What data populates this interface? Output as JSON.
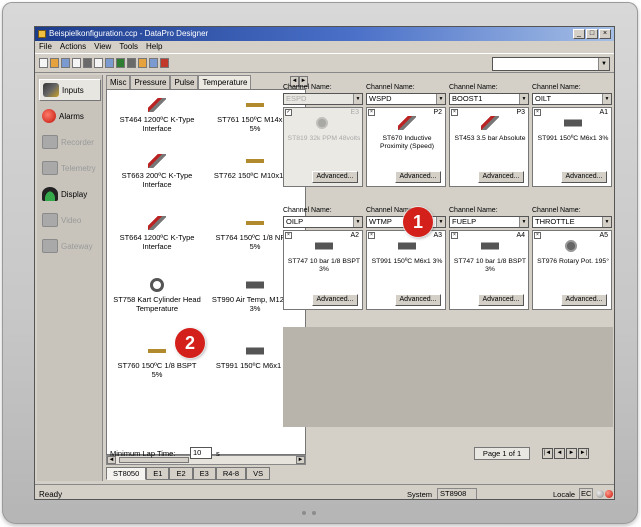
{
  "window": {
    "title": "Beispielkonfiguration.ccp - DataPro Designer",
    "controls": [
      "_",
      "□",
      "×"
    ]
  },
  "menu": [
    "File",
    "Actions",
    "View",
    "Tools",
    "Help"
  ],
  "toolbar_icons": [
    "new-icon",
    "open-icon",
    "save-icon",
    "copy-icon",
    "paste-icon",
    "print-icon",
    "send-icon",
    "receive-icon",
    "ecu-icon",
    "settings-icon",
    "flash-icon",
    "stop-icon"
  ],
  "leftnav": [
    {
      "label": "Inputs",
      "icon": "sensor-icon",
      "state": "active"
    },
    {
      "label": "Alarms",
      "icon": "alarm-icon",
      "state": "normal"
    },
    {
      "label": "Recorder",
      "icon": "recorder-icon",
      "state": "disabled"
    },
    {
      "label": "Telemetry",
      "icon": "telemetry-icon",
      "state": "disabled"
    },
    {
      "label": "Display",
      "icon": "display-icon",
      "state": "normal"
    },
    {
      "label": "Video",
      "icon": "video-icon",
      "state": "disabled"
    },
    {
      "label": "Gateway",
      "icon": "gateway-icon",
      "state": "disabled"
    }
  ],
  "library": {
    "tabs": [
      "Misc",
      "Pressure",
      "Pulse",
      "Temperature"
    ],
    "active_tab": "Temperature",
    "sensors": [
      {
        "label": "ST464 1200ºC K-Type Interface",
        "icon": "thermocouple-icon"
      },
      {
        "label": "ST761 150ºC M14x1.5 5%",
        "icon": "brass-sensor-icon"
      },
      {
        "label": "ST663 200ºC K-Type Interface",
        "icon": "thermocouple-icon"
      },
      {
        "label": "ST762 150ºC M10x1 5%",
        "icon": "brass-sensor-icon"
      },
      {
        "label": "ST664 1200ºC K-Type Interface",
        "icon": "thermocouple-icon"
      },
      {
        "label": "ST764 150ºC 1/8 NPTF 5%",
        "icon": "brass-sensor-icon"
      },
      {
        "label": "ST758 Kart Cylinder Head Temperature",
        "icon": "ring-sensor-icon"
      },
      {
        "label": "ST990 Air Temp, M12x1.5 3%",
        "icon": "plug-sensor-icon"
      },
      {
        "label": "ST760 150ºC 1/8 BSPT 5%",
        "icon": "brass-sensor-icon"
      },
      {
        "label": "ST991 150ºC M6x1 3%",
        "icon": "plug-sensor-icon"
      }
    ]
  },
  "channels": [
    {
      "label": "Channel Name:",
      "name": "ESPD",
      "id": "E3",
      "desc": "ST819 32k PPM 48volts",
      "icon": "gear-sensor-icon",
      "disabled": true,
      "advanced": "Advanced..."
    },
    {
      "label": "Channel Name:",
      "name": "WSPD",
      "id": "P2",
      "desc": "ST670 Inductive Proximity (Speed)",
      "icon": "probe-sensor-icon",
      "disabled": false,
      "advanced": "Advanced..."
    },
    {
      "label": "Channel Name:",
      "name": "BOOST1",
      "id": "P3",
      "desc": "ST453 3.5 bar Absolute",
      "icon": "pressure-sensor-icon",
      "disabled": false,
      "advanced": "Advanced..."
    },
    {
      "label": "Channel Name:",
      "name": "OILT",
      "id": "A1",
      "desc": "ST991 150ºC M6x1 3%",
      "icon": "plug-sensor-icon",
      "disabled": false,
      "advanced": "Advanced..."
    },
    {
      "label": "Channel Name:",
      "name": "OILP",
      "id": "A2",
      "desc": "ST747 10 bar 1/8 BSPT 3%",
      "icon": "pressure-plug-icon",
      "disabled": false,
      "advanced": "Advanced..."
    },
    {
      "label": "Channel Name:",
      "name": "WTMP",
      "id": "A3",
      "desc": "ST991 150ºC M6x1 3%",
      "icon": "plug-sensor-icon",
      "disabled": false,
      "advanced": "Advanced..."
    },
    {
      "label": "Channel Name:",
      "name": "FUELP",
      "id": "A4",
      "desc": "ST747 10 bar 1/8 BSPT 3%",
      "icon": "pressure-plug-icon",
      "disabled": false,
      "advanced": "Advanced..."
    },
    {
      "label": "Channel Name:",
      "name": "THROTTLE",
      "id": "A5",
      "desc": "ST976 Rotary Pot. 195°",
      "icon": "rotary-pot-icon",
      "disabled": false,
      "advanced": "Advanced..."
    }
  ],
  "bottom": {
    "min_lap_label": "Minimum Lap Time:",
    "min_lap_value": "10",
    "min_lap_unit": "s",
    "page": "Page 1 of 1",
    "pager": [
      "|◄",
      "◄",
      "►",
      "►|"
    ]
  },
  "unit_tabs": [
    "ST8050",
    "E1",
    "E2",
    "E3",
    "R4-8",
    "VS"
  ],
  "status": {
    "ready": "Ready",
    "system_label": "System",
    "system_value": "ST8908",
    "locale_label": "Locale",
    "locale_value": "EC"
  },
  "callouts": [
    "1",
    "2"
  ],
  "colors": {
    "titlebar": "#1c3c8c",
    "callout": "#d4201a",
    "face": "#d4d0c8"
  }
}
